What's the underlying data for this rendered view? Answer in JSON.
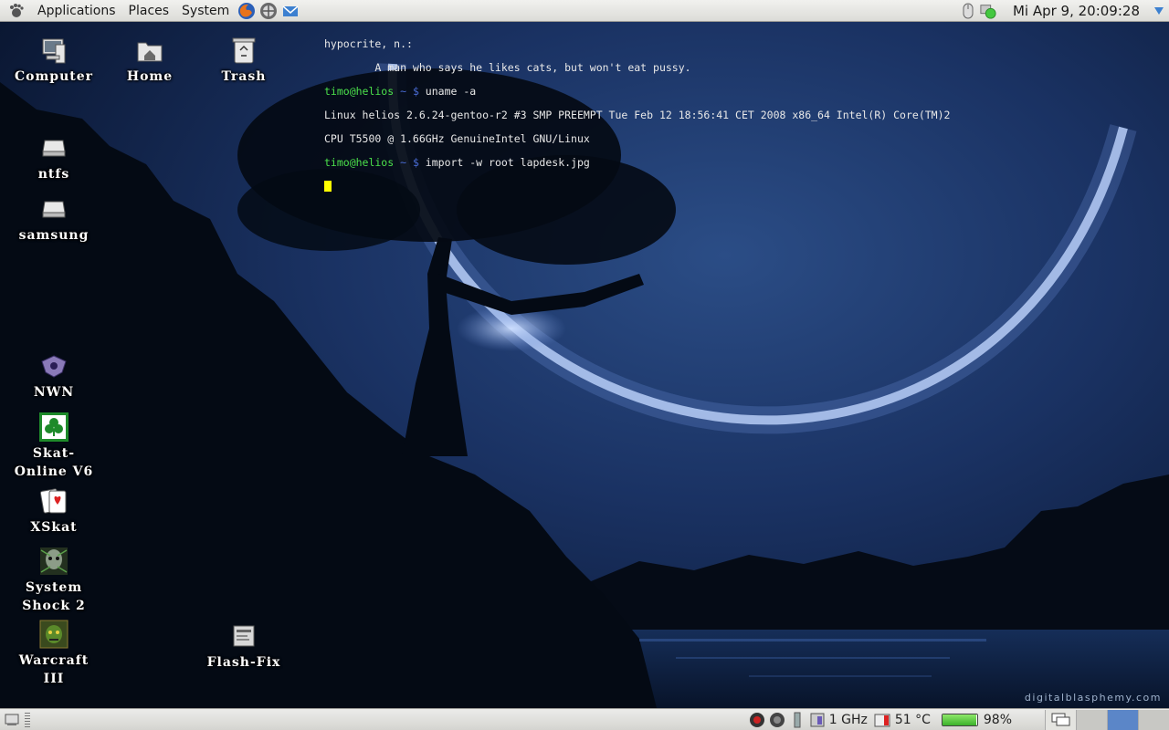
{
  "top_panel": {
    "menus": {
      "applications": "Applications",
      "places": "Places",
      "system": "System"
    },
    "clock": "Mi Apr  9, 20:09:28"
  },
  "desktop_icons": {
    "computer": "Computer",
    "home": "Home",
    "trash": "Trash",
    "ntfs": "ntfs",
    "samsung": "samsung",
    "nwn": "NWN",
    "skat_online_line1": "Skat-",
    "skat_online_line2": "Online V6",
    "xskat": "XSkat",
    "system_shock_line1": "System",
    "system_shock_line2": "Shock 2",
    "warcraft_line1": "Warcraft",
    "warcraft_line2": "III",
    "flash_fix": "Flash-Fix"
  },
  "terminal": {
    "line1": "hypocrite, n.:",
    "line2": "        A man who says he likes cats, but won't eat pussy.",
    "prompt_user": "timo@helios",
    "prompt_path": " ~ $ ",
    "cmd1": "uname -a",
    "out1": "Linux helios 2.6.24-gentoo-r2 #3 SMP PREEMPT Tue Feb 12 18:56:41 CET 2008 x86_64 Intel(R) Core(TM)2",
    "out2": "CPU T5500 @ 1.66GHz GenuineIntel GNU/Linux",
    "cmd2": "import -w root lapdesk.jpg"
  },
  "watermark": "digitalblasphemy.com",
  "bottom_panel": {
    "cpu_freq": "1 GHz",
    "temperature": "51 °C",
    "battery_percent": "98%",
    "battery_level": 0.98
  },
  "colors": {
    "terminal_prompt": "#4be04b",
    "terminal_path": "#4a6cd6",
    "cursor": "#ffff00",
    "panel_bg": "#e4e4e0",
    "active_workspace": "#5b86c8"
  },
  "icons": [
    "gnome-foot-icon",
    "firefox-icon",
    "network-icon",
    "mail-icon",
    "computer-icon",
    "home-folder-icon",
    "trash-icon",
    "drive-icon",
    "game-icon",
    "clover-icon",
    "cards-icon",
    "battery-icon",
    "thermometer-icon"
  ]
}
